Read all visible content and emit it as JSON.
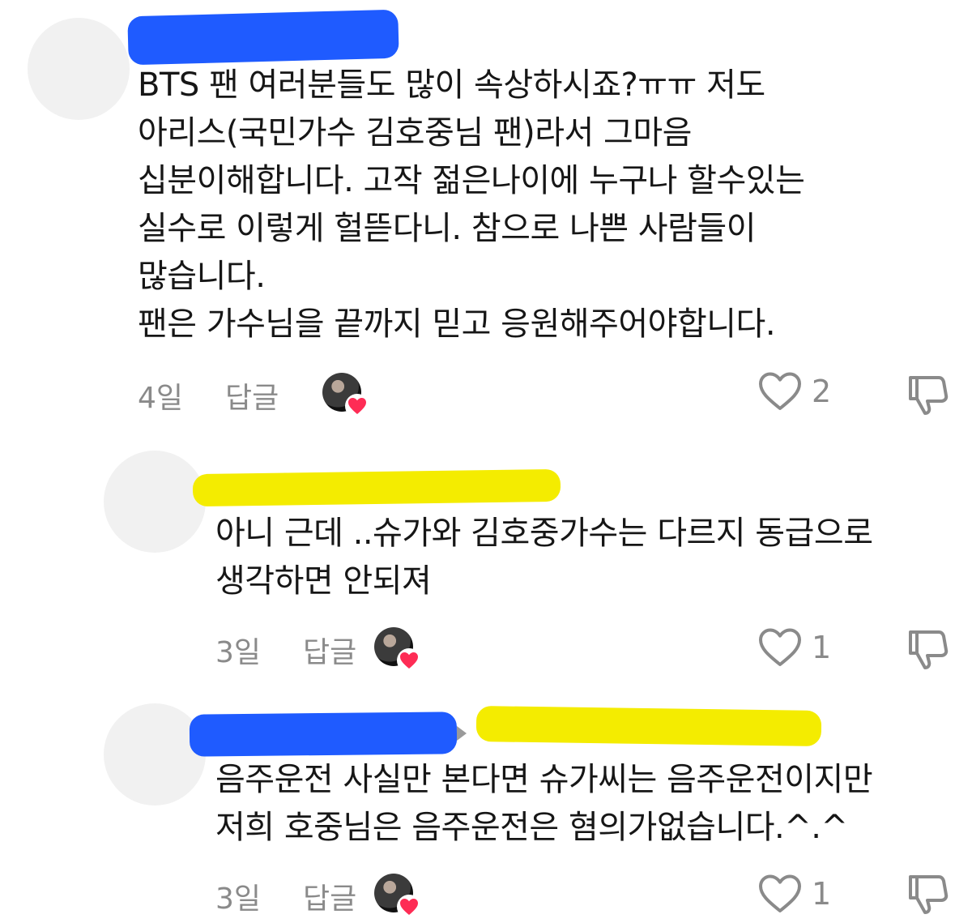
{
  "comments": [
    {
      "lines": [
        "BTS 팬 여러분들도 많이 속상하시죠?ㅠㅠ 저도",
        "아리스(국민가수 김호중님 팬)라서 그마음",
        "십분이해합니다. 고작 젊은나이에 누구나 할수있는",
        "실수로 이렇게 헐뜯다니. 참으로 나쁜 사람들이",
        "많습니다.",
        "팬은 가수님을 끝까지 믿고 응원해주어야합니다."
      ],
      "time": "4일",
      "reply_label": "답글",
      "likes": "2"
    },
    {
      "lines": [
        "아니 근데 ..슈가와 김호중가수는 다르지 동급으로",
        "생각하면 안되져"
      ],
      "time": "3일",
      "reply_label": "답글",
      "likes": "1"
    },
    {
      "lines": [
        "음주운전 사실만 본다면 슈가씨는 음주운전이지만",
        "저희 호중님은 음주운전은 혐의가없습니다.^.^"
      ],
      "time": "3일",
      "reply_label": "답글",
      "likes": "1"
    }
  ],
  "icons": {
    "like": "heart-outline-icon",
    "dislike": "thumbs-down-icon",
    "creator_liked": "heart-badge-icon"
  },
  "colors": {
    "redaction_blue": "#1f5bff",
    "redaction_yellow": "#f4ec00",
    "heart_badge": "#fe2c55",
    "meta_text": "#8a8a8a"
  }
}
